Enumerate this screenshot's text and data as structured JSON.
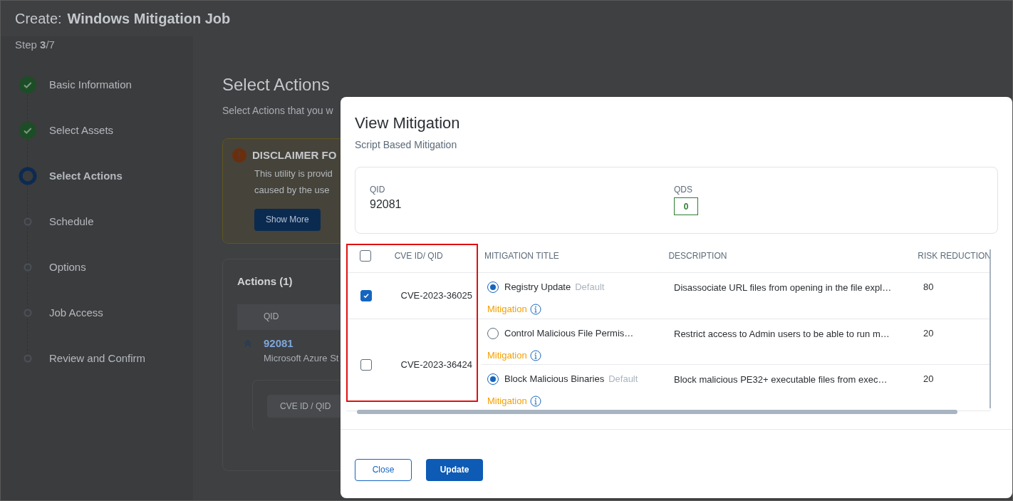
{
  "header": {
    "prefix": "Create:",
    "title": "Windows Mitigation Job",
    "step": "Step **3**/7"
  },
  "steps": [
    {
      "label": "Basic Information",
      "kind": "done"
    },
    {
      "label": "Select Assets",
      "kind": "done"
    },
    {
      "label": "Select Actions",
      "kind": "current"
    },
    {
      "label": "Schedule",
      "kind": "pending"
    },
    {
      "label": "Options",
      "kind": "pending"
    },
    {
      "label": "Job Access",
      "kind": "pending"
    },
    {
      "label": "Review and Confirm",
      "kind": "pending"
    }
  ],
  "main": {
    "title": "Select Actions",
    "subtitle": "Select Actions that you w",
    "disclaimer": {
      "title": "DISCLAIMER FO",
      "lines": [
        "This utility is provid",
        "caused by the use"
      ],
      "button": "Show More"
    },
    "actions": {
      "title": "Actions (1)",
      "column": "QID",
      "qid": "92081",
      "name": "Microsoft Azure St",
      "inner_column": "CVE ID / QID"
    }
  },
  "modal": {
    "title": "View Mitigation",
    "subtitle": "Script Based Mitigation",
    "summary": {
      "qid_label": "QID",
      "qid": "92081",
      "qds_label": "QDS",
      "qds": "0"
    },
    "columns": [
      "CVE ID/ QID",
      "MITIGATION TITLE",
      "DESCRIPTION",
      "RISK REDUCTION"
    ],
    "select_all_checked": false,
    "cves": [
      {
        "id": "CVE-2023-36025",
        "checked": true,
        "mitigations": [
          {
            "title": "Registry Update",
            "default": "Default",
            "selected": true,
            "type": "Mitigation",
            "description": "Disassociate URL files from opening in the file expl…",
            "risk": "80"
          }
        ]
      },
      {
        "id": "CVE-2023-36424",
        "checked": false,
        "mitigations": [
          {
            "title": "Control Malicious File Permis…",
            "selected": false,
            "type": "Mitigation",
            "description": "Restrict access to Admin users to be able to run m…",
            "risk": "20"
          },
          {
            "title": "Block Malicious Binaries",
            "default": "Default",
            "selected": true,
            "type": "Mitigation",
            "description": "Block malicious PE32+ executable files from exec…",
            "risk": "20"
          }
        ]
      }
    ],
    "buttons": [
      {
        "label": "Close",
        "kind": "secondary"
      },
      {
        "label": "Update",
        "kind": "primary"
      }
    ]
  }
}
